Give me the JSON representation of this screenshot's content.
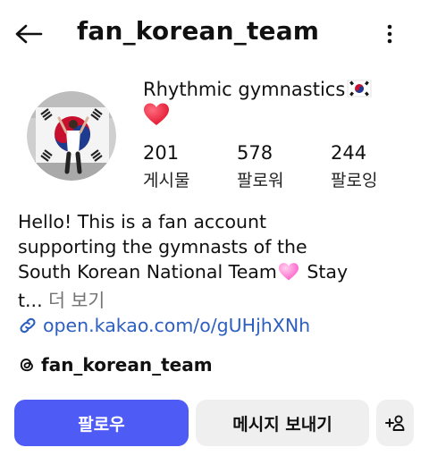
{
  "header": {
    "username": "fan_korean_team"
  },
  "profile": {
    "display_name": "Rhythmic gymnastics",
    "stats": [
      {
        "count": "201",
        "label": "게시물"
      },
      {
        "count": "578",
        "label": "팔로워"
      },
      {
        "count": "244",
        "label": "팔로잉"
      }
    ],
    "bio_lines": [
      "Hello! This is a fan account",
      "supporting the gymnasts of the",
      "South Korean National Team",
      "Stay",
      "t..."
    ],
    "bio_more": "더 보기",
    "link": "open.kakao.com/o/gUHjhXNh",
    "threads_handle": "fan_korean_team"
  },
  "actions": {
    "follow_label": "팔로우",
    "message_label": "메시지 보내기"
  },
  "icons": {
    "back": "arrow-left-icon",
    "more": "vertical-dots-icon",
    "flag": "south-korea-flag-icon",
    "heart": "red-heart-icon",
    "pink_heart": "pink-heart-icon",
    "link": "chain-link-icon",
    "threads": "threads-logo-icon",
    "add_user": "add-person-icon"
  },
  "colors": {
    "accent": "#4f5bf5",
    "link": "#2d5fc0",
    "secondary_button": "#efefef",
    "muted_text": "#737373"
  }
}
